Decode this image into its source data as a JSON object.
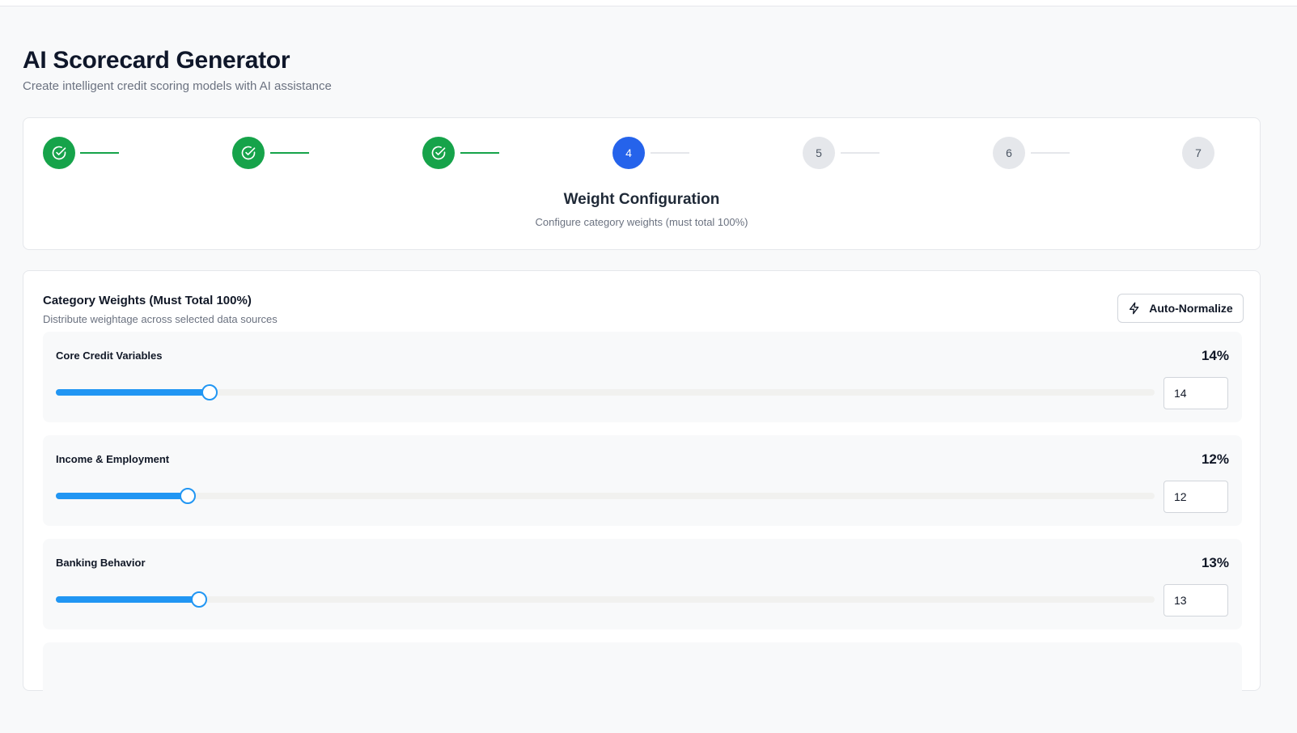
{
  "header": {
    "title": "AI Scorecard Generator",
    "subtitle": "Create intelligent credit scoring models with AI assistance"
  },
  "stepper": {
    "steps": [
      {
        "label": "",
        "status": "done",
        "icon": "check-circle-icon"
      },
      {
        "label": "",
        "status": "done",
        "icon": "check-circle-icon"
      },
      {
        "label": "",
        "status": "done",
        "icon": "check-circle-icon"
      },
      {
        "label": "4",
        "status": "active"
      },
      {
        "label": "5",
        "status": "pending"
      },
      {
        "label": "6",
        "status": "pending"
      },
      {
        "label": "7",
        "status": "pending"
      }
    ],
    "current_title": "Weight Configuration",
    "current_description": "Configure category weights (must total 100%)"
  },
  "weights": {
    "title": "Category Weights (Must Total 100%)",
    "subtitle": "Distribute weightage across selected data sources",
    "auto_normalize_label": "Auto-Normalize",
    "auto_normalize_icon": "lightning-icon",
    "categories": [
      {
        "name": "Core Credit Variables",
        "percent_label": "14%",
        "value": "14",
        "slider_fraction": 0.14
      },
      {
        "name": "Income & Employment",
        "percent_label": "12%",
        "value": "12",
        "slider_fraction": 0.12
      },
      {
        "name": "Banking Behavior",
        "percent_label": "13%",
        "value": "13",
        "slider_fraction": 0.13
      }
    ]
  },
  "colors": {
    "done": "#16a34a",
    "active": "#2563eb",
    "pending": "#e5e7eb",
    "slider": "#2196f3"
  }
}
